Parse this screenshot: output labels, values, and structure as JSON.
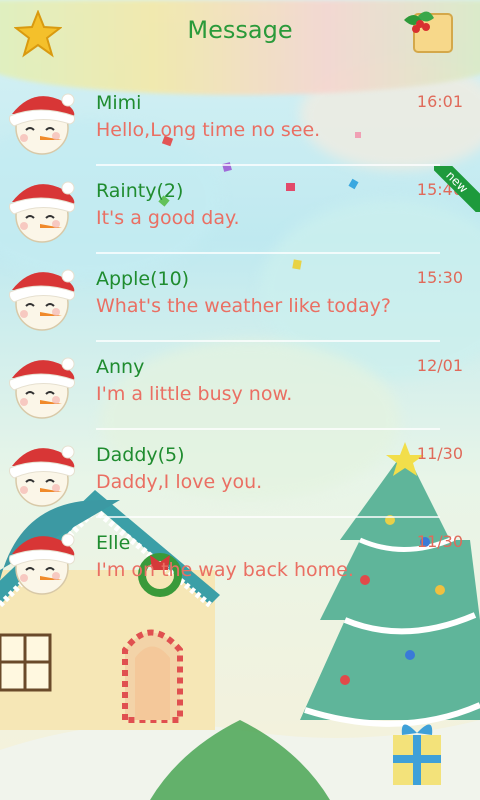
{
  "header": {
    "title": "Message",
    "star_icon": "star-icon",
    "holly_icon": "holly-scroll-icon"
  },
  "conversations": [
    {
      "name": "Mimi",
      "message": "Hello,Long time no see.",
      "time": "16:01",
      "new": false
    },
    {
      "name": "Rainty(2)",
      "message": "It's a good day.",
      "time": "15:40",
      "new": true,
      "badge": "new"
    },
    {
      "name": "Apple(10)",
      "message": "What's the weather like today?",
      "time": "15:30",
      "new": false
    },
    {
      "name": "Anny",
      "message": "I'm a little busy now.",
      "time": "12/01",
      "new": false
    },
    {
      "name": "Daddy(5)",
      "message": "Daddy,I love you.",
      "time": "11/30",
      "new": false
    },
    {
      "name": "Elle",
      "message": "I'm on the way back home.",
      "time": "11/30",
      "new": false
    }
  ],
  "colors": {
    "name": "#1f8c2f",
    "message": "#ea6f63",
    "time": "#e06a5a",
    "title": "#2a9a3a",
    "badge": "#1e9a3c"
  }
}
